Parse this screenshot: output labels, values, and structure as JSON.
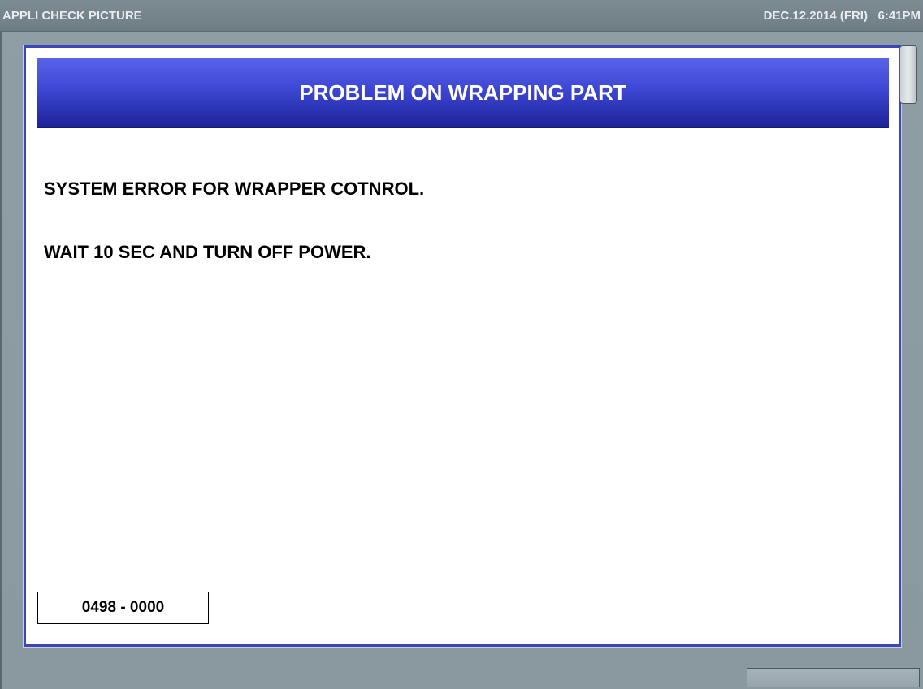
{
  "topbar": {
    "app_title": "APPLI CHECK PICTURE",
    "datetime": "DEC.12.2014 (FRI)   6:41PM"
  },
  "dialog": {
    "title": "PROBLEM ON WRAPPING PART",
    "messages": [
      "SYSTEM ERROR FOR WRAPPER COTNROL.",
      "WAIT 10 SEC AND TURN OFF POWER."
    ],
    "error_code": "0498 - 0000"
  },
  "colors": {
    "header_gradient_top": "#5a64e8",
    "header_gradient_bottom": "#1c2297",
    "dialog_border": "#3d46b8",
    "background": "#8c9aa2"
  }
}
